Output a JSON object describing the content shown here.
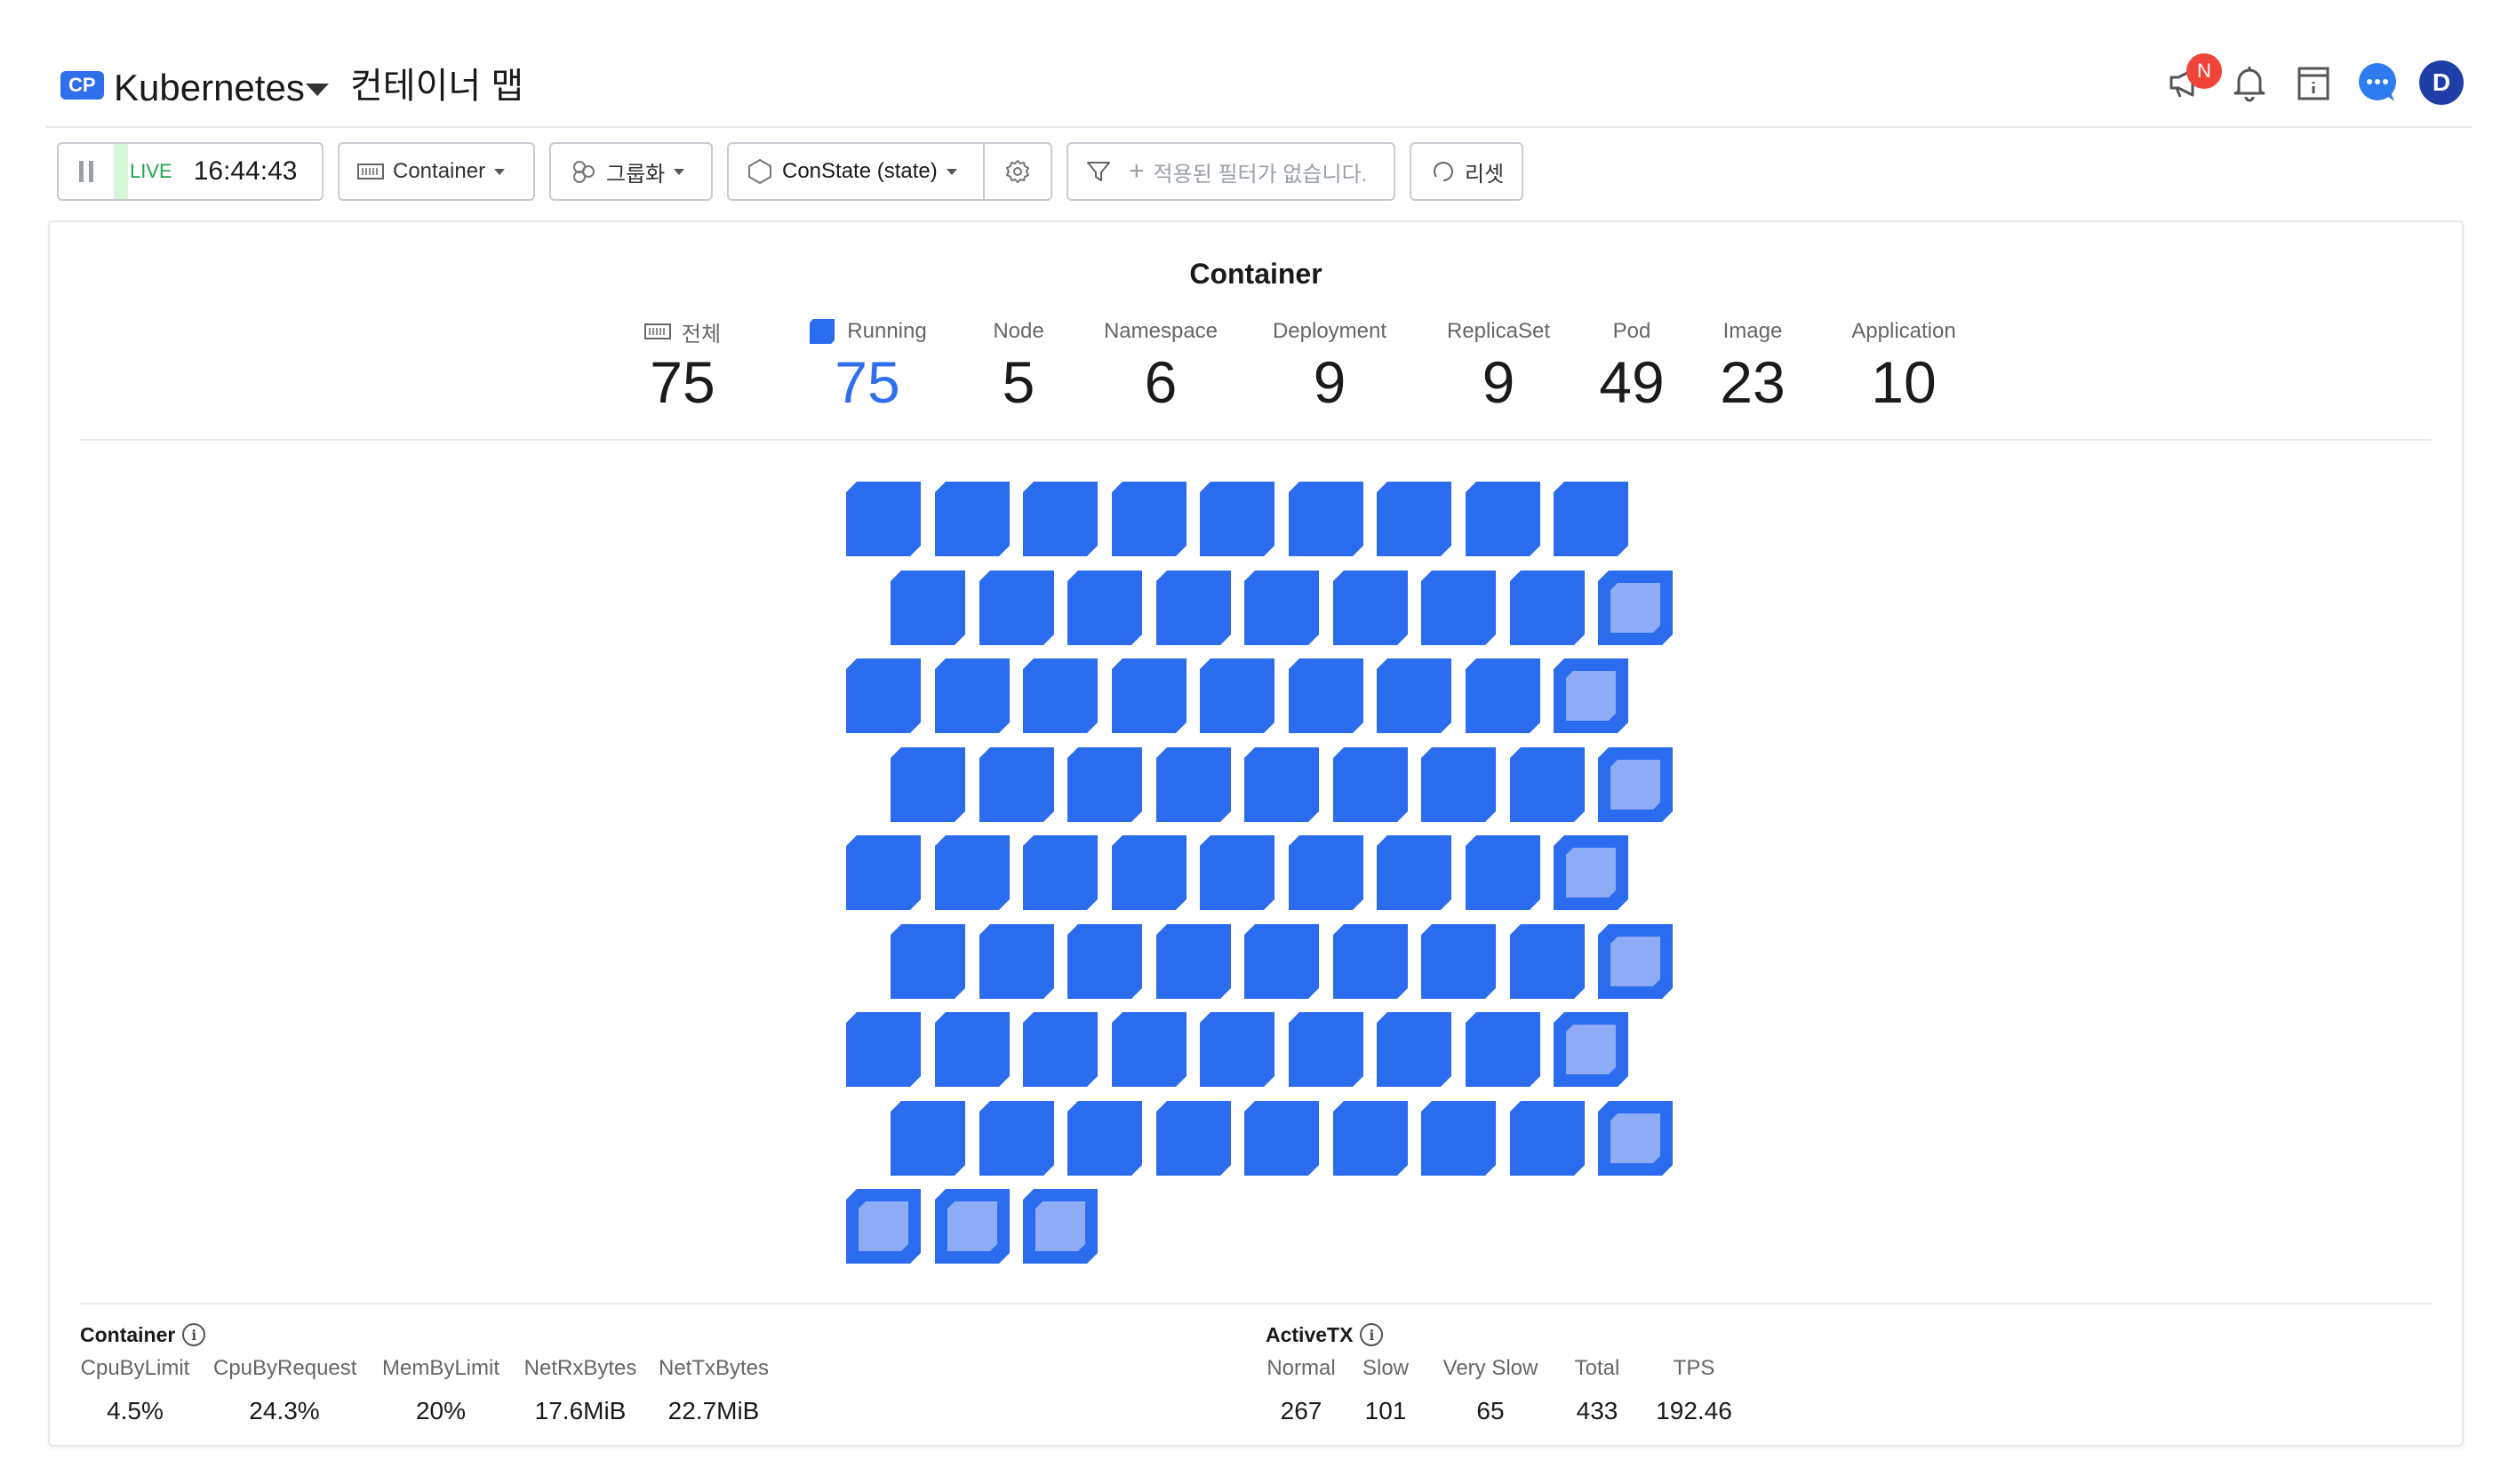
{
  "header": {
    "badge": "CP",
    "cluster": "Kubernetes",
    "title": "컨테이너 맵",
    "notification_badge": "N",
    "avatar_letter": "D"
  },
  "toolbar": {
    "live_label": "LIVE",
    "time": "16:44:43",
    "object_type": "Container",
    "grouping": "그룹화",
    "color_by": "ConState (state)",
    "filter_placeholder": "적용된 필터가 없습니다.",
    "reset": "리셋"
  },
  "panel": {
    "title": "Container",
    "stats": [
      {
        "label": "전체",
        "value": "75",
        "icon": "grid-icon"
      },
      {
        "label": "Running",
        "value": "75",
        "icon": "running-square-icon"
      },
      {
        "label": "Node",
        "value": "5"
      },
      {
        "label": "Namespace",
        "value": "6"
      },
      {
        "label": "Deployment",
        "value": "9"
      },
      {
        "label": "ReplicaSet",
        "value": "9"
      },
      {
        "label": "Pod",
        "value": "49"
      },
      {
        "label": "Image",
        "value": "23"
      },
      {
        "label": "Application",
        "value": "10"
      }
    ],
    "map": {
      "rows": [
        "FFFFFFFFF",
        "FFFFFFFFO",
        "FFFFFFFFO",
        "FFFFFFFFO",
        "FFFFFFFFO",
        "FFFFFFFFO",
        "FFFFFFFFO",
        "FFFFFFFFO",
        "OOO"
      ],
      "fill_color": "#2b6bed",
      "light_color": "#8eacf5"
    }
  },
  "metrics": {
    "container": {
      "title": "Container",
      "items": [
        {
          "label": "CpuByLimit",
          "value": "4.5%"
        },
        {
          "label": "CpuByRequest",
          "value": "24.3%"
        },
        {
          "label": "MemByLimit",
          "value": "20%"
        },
        {
          "label": "NetRxBytes",
          "value": "17.6MiB"
        },
        {
          "label": "NetTxBytes",
          "value": "22.7MiB"
        }
      ]
    },
    "activetx": {
      "title": "ActiveTX",
      "items": [
        {
          "label": "Normal",
          "value": "267"
        },
        {
          "label": "Slow",
          "value": "101"
        },
        {
          "label": "Very Slow",
          "value": "65"
        },
        {
          "label": "Total",
          "value": "433"
        },
        {
          "label": "TPS",
          "value": "192.46"
        }
      ]
    }
  }
}
